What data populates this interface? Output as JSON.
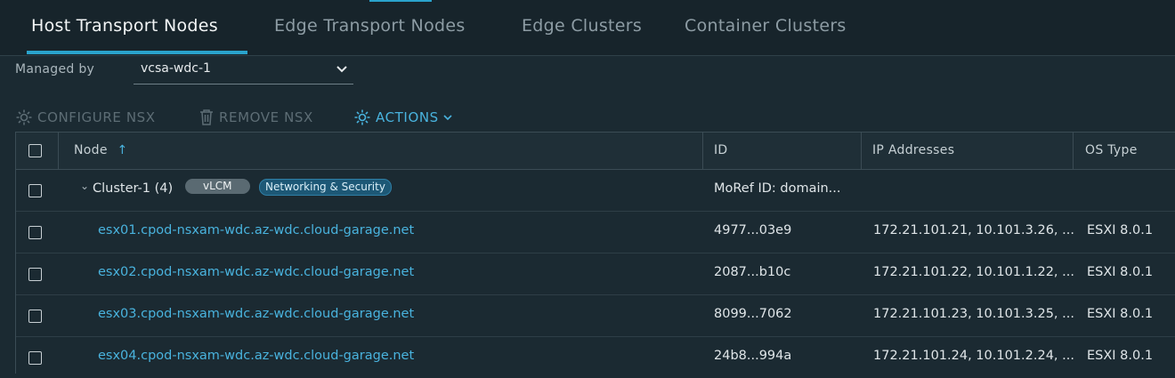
{
  "tabs": [
    {
      "label": "Host Transport Nodes",
      "active": true
    },
    {
      "label": "Edge Transport Nodes",
      "active": false
    },
    {
      "label": "Edge Clusters",
      "active": false
    },
    {
      "label": "Container Clusters",
      "active": false
    }
  ],
  "managed_by": {
    "label": "Managed by",
    "value": "vcsa-wdc-1"
  },
  "toolbar": {
    "configure_nsx": "CONFIGURE NSX",
    "remove_nsx": "REMOVE NSX",
    "actions": "ACTIONS"
  },
  "colors": {
    "accent": "#49b3de",
    "background": "#1b2a32",
    "disabled": "#5d6d75"
  },
  "table": {
    "columns": [
      "Node",
      "ID",
      "IP Addresses",
      "OS Type"
    ],
    "sort_indicator": "↑",
    "cluster_row": {
      "expander": "⌄",
      "name": "Cluster-1 (4)",
      "badges": [
        "vLCM",
        "Networking & Security"
      ],
      "id": "MoRef ID: domain..."
    },
    "rows": [
      {
        "node": "esx01.cpod-nsxam-wdc.az-wdc.cloud-garage.net",
        "id": "4977...03e9",
        "ip": "172.21.101.21, 10.101.3.26, ...",
        "os": "ESXI 8.0.1"
      },
      {
        "node": "esx02.cpod-nsxam-wdc.az-wdc.cloud-garage.net",
        "id": "2087...b10c",
        "ip": "172.21.101.22, 10.101.1.22, ...",
        "os": "ESXI 8.0.1"
      },
      {
        "node": "esx03.cpod-nsxam-wdc.az-wdc.cloud-garage.net",
        "id": "8099...7062",
        "ip": "172.21.101.23, 10.101.3.25, ...",
        "os": "ESXI 8.0.1"
      },
      {
        "node": "esx04.cpod-nsxam-wdc.az-wdc.cloud-garage.net",
        "id": "24b8...994a",
        "ip": "172.21.101.24, 10.101.2.24, ...",
        "os": "ESXI 8.0.1"
      }
    ]
  }
}
